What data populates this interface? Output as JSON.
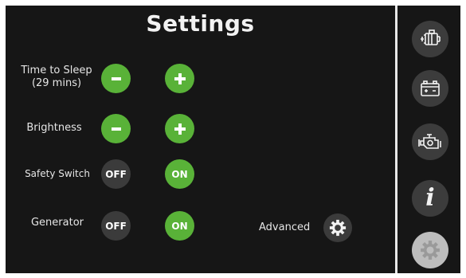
{
  "header": {
    "title": "Settings"
  },
  "rows": {
    "time_to_sleep": {
      "label_line1": "Time to Sleep",
      "label_line2": "(29 mins)"
    },
    "brightness": {
      "label": "Brightness"
    },
    "safety_switch": {
      "label": "Safety Switch",
      "off_label": "OFF",
      "on_label": "ON"
    },
    "generator": {
      "label": "Generator",
      "off_label": "OFF",
      "on_label": "ON"
    }
  },
  "advanced": {
    "label": "Advanced"
  },
  "icons": {
    "decrease": "minus-icon",
    "increase": "plus-icon",
    "advanced": "gear-icon",
    "sidebar": [
      "motor-icon",
      "battery-icon",
      "engine-icon",
      "info-icon",
      "gear-icon"
    ]
  },
  "sidebar": {
    "info_glyph": "i"
  },
  "colors": {
    "background": "#161616",
    "accent_green": "#59b238",
    "button_dark": "#3b3b3b",
    "sidebar_button": "#3c3c3c",
    "sidebar_active": "#bdbdbd",
    "divider": "#e8e8e8"
  }
}
